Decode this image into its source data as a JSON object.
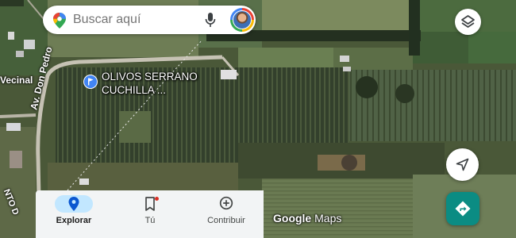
{
  "search": {
    "placeholder": "Buscar aquí",
    "google_icon": "google-g-icon",
    "mic_icon": "microphone-icon",
    "avatar_icon": "user-avatar"
  },
  "map": {
    "layers_icon": "layers-icon",
    "place": {
      "name": "OLIVOS SERRANO CUCHILLA ...",
      "pin_icon": "flag-pin-icon",
      "pin_color": "#4285f4"
    },
    "road_labels": {
      "vecinal": "Vecinal",
      "pedro": "Av. Don Pedro",
      "ento": "NTO D"
    },
    "compass_icon": "navigation-arrow-icon",
    "directions_icon": "directions-icon",
    "directions_color": "#0b8c83",
    "attribution": {
      "brand": "Google",
      "product": "Maps"
    }
  },
  "bottom_nav": {
    "items": [
      {
        "label": "Explorar",
        "icon": "location-pin-icon",
        "active": true
      },
      {
        "label": "Tú",
        "icon": "bookmark-icon",
        "active": false
      },
      {
        "label": "Contribuir",
        "icon": "add-circle-icon",
        "active": false
      }
    ],
    "active_color": "#c2e7ff"
  }
}
